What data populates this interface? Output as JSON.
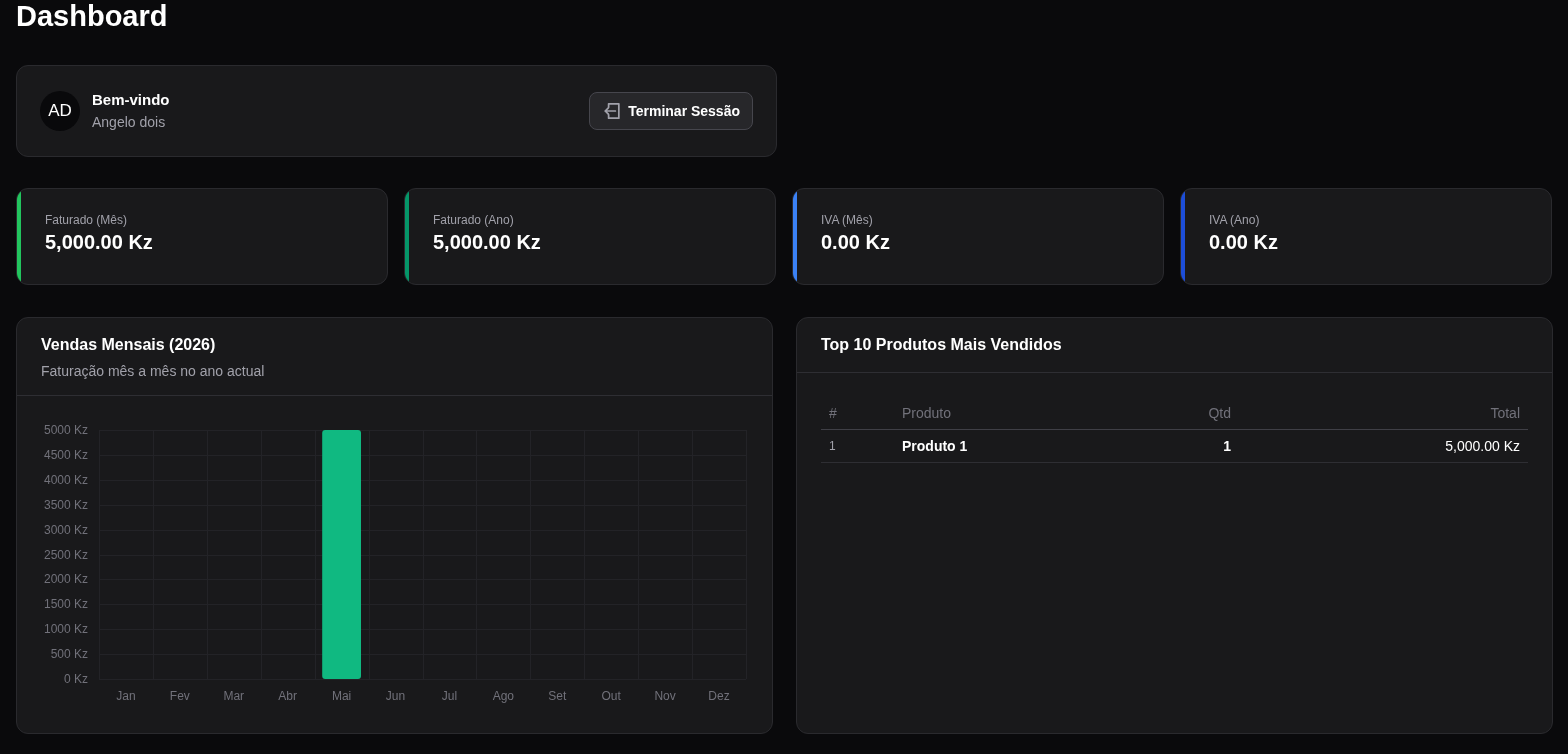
{
  "page": {
    "title": "Dashboard"
  },
  "user_card": {
    "avatar_initials": "AD",
    "greeting": "Bem-vindo",
    "user_name": "Angelo dois",
    "logout_button": "Terminar Sessão"
  },
  "stats": [
    {
      "label": "Faturado (Mês)",
      "value": "5,000.00 Kz",
      "color": "#22c55e"
    },
    {
      "label": "Faturado (Ano)",
      "value": "5,000.00 Kz",
      "color": "#059669"
    },
    {
      "label": "IVA (Mês)",
      "value": "0.00 Kz",
      "color": "#3b82f6"
    },
    {
      "label": "IVA (Ano)",
      "value": "0.00 Kz",
      "color": "#1d4ed8"
    }
  ],
  "sales_card": {
    "title": "Vendas Mensais (2026)",
    "subtitle": "Faturação mês a mês no ano actual",
    "chart_data": {
      "type": "bar",
      "grid": true,
      "categories": [
        "Jan",
        "Fev",
        "Mar",
        "Abr",
        "Mai",
        "Jun",
        "Jul",
        "Ago",
        "Set",
        "Out",
        "Nov",
        "Dez"
      ],
      "values": [
        0,
        0,
        0,
        0,
        5000,
        0,
        0,
        0,
        0,
        0,
        0,
        0
      ],
      "ylim": [
        0,
        5000
      ],
      "yticks": [
        {
          "value": 0,
          "label": "0 Kz"
        },
        {
          "value": 500,
          "label": "500 Kz"
        },
        {
          "value": 1000,
          "label": "1000 Kz"
        },
        {
          "value": 1500,
          "label": "1500 Kz"
        },
        {
          "value": 2000,
          "label": "2000 Kz"
        },
        {
          "value": 2500,
          "label": "2500 Kz"
        },
        {
          "value": 3000,
          "label": "3000 Kz"
        },
        {
          "value": 3500,
          "label": "3500 Kz"
        },
        {
          "value": 4000,
          "label": "4000 Kz"
        },
        {
          "value": 4500,
          "label": "4500 Kz"
        },
        {
          "value": 5000,
          "label": "5000 Kz"
        }
      ]
    }
  },
  "products_card": {
    "title": "Top 10 Produtos Mais Vendidos",
    "table": {
      "columns": [
        "#",
        "Produto",
        "Qtd",
        "Total"
      ],
      "rows": [
        [
          "1",
          "Produto 1",
          "1",
          "5,000.00 Kz"
        ]
      ]
    }
  }
}
